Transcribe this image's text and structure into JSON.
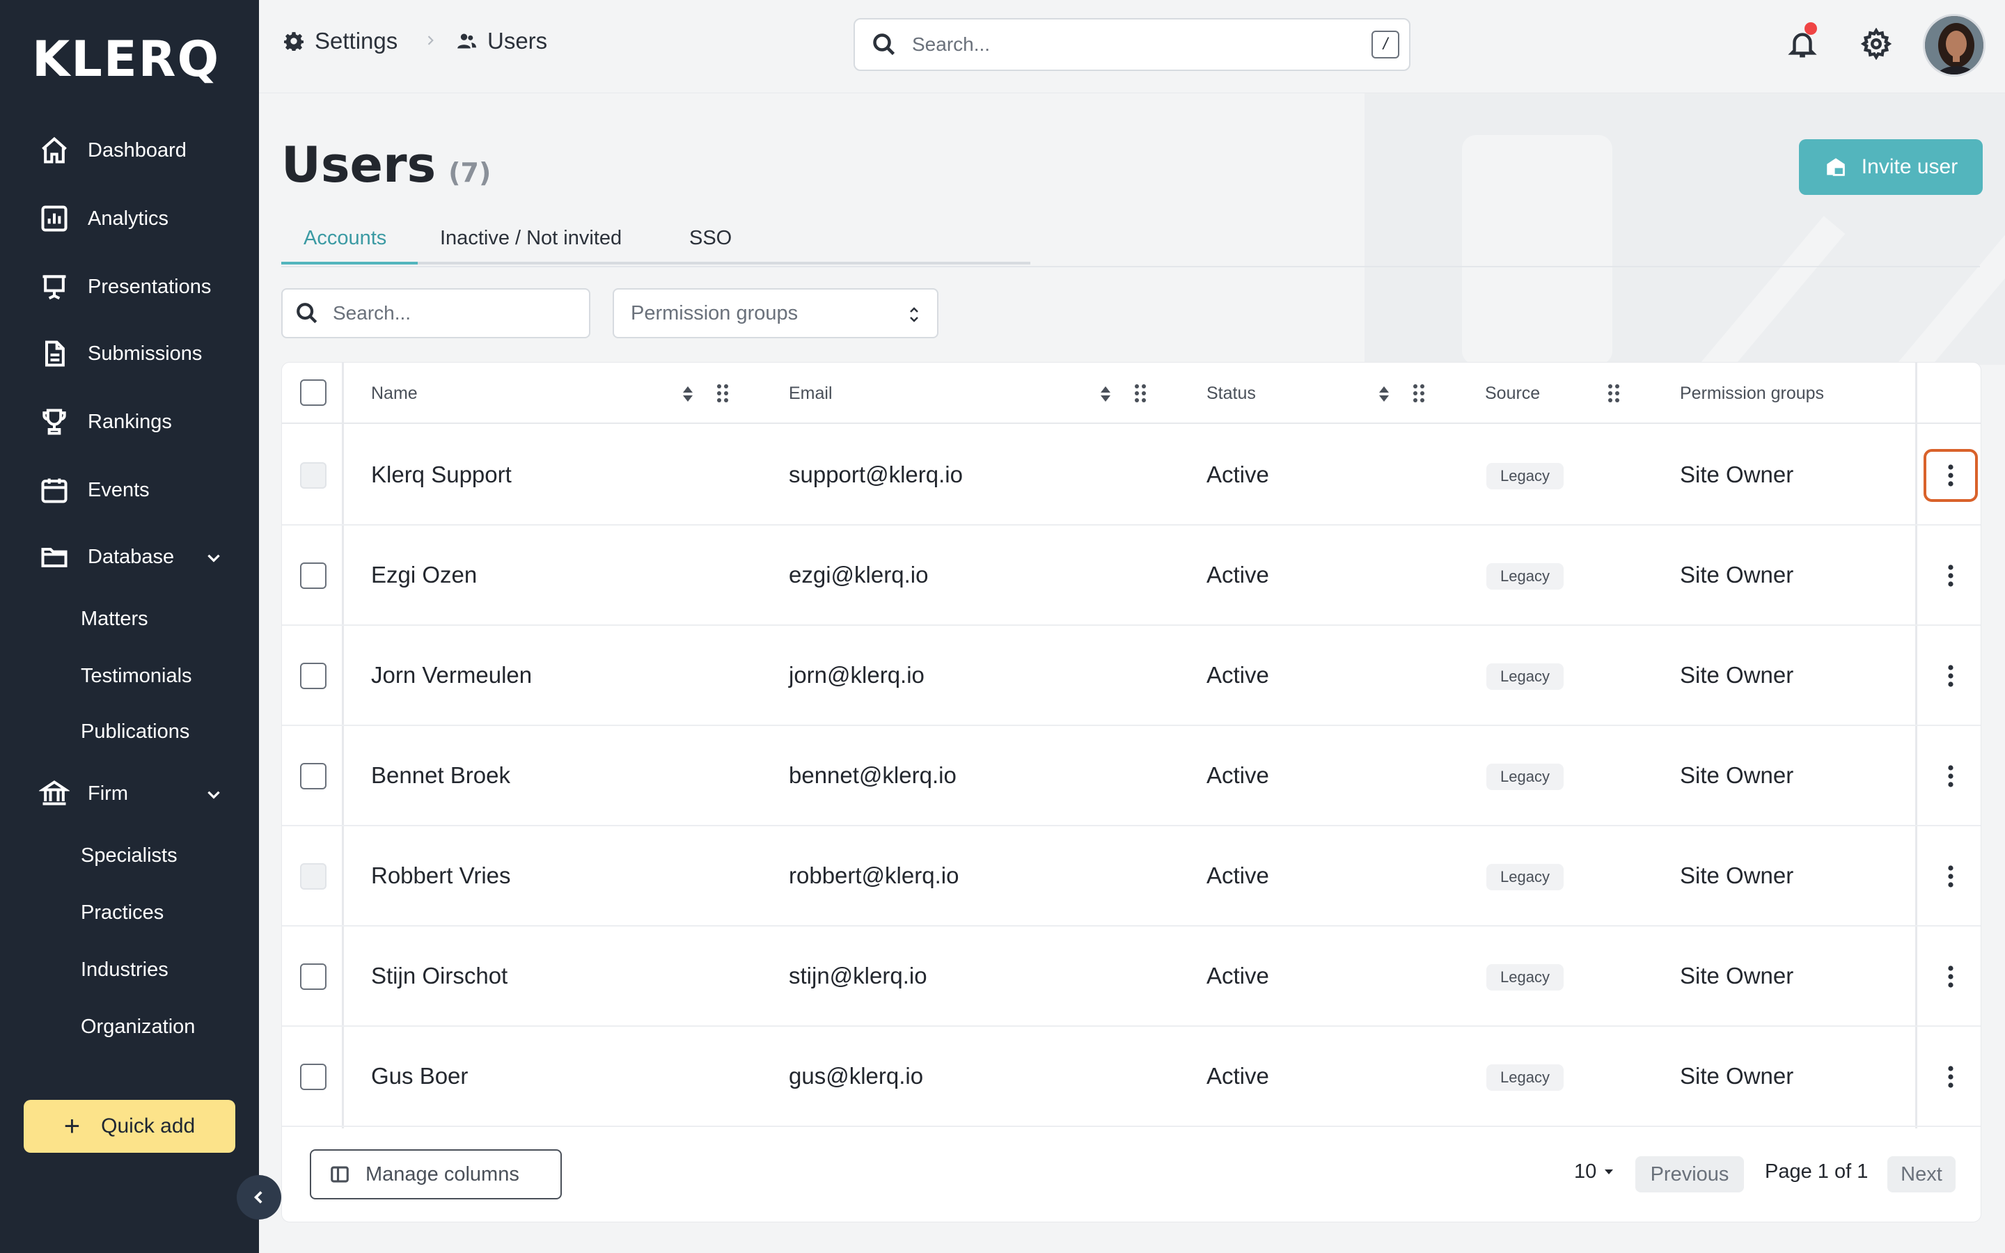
{
  "brand": {
    "logo_text": "KLERQ"
  },
  "sidebar": {
    "items": [
      {
        "label": "Dashboard",
        "icon": "home-icon"
      },
      {
        "label": "Analytics",
        "icon": "chart-icon"
      },
      {
        "label": "Presentations",
        "icon": "presentation-icon"
      },
      {
        "label": "Submissions",
        "icon": "document-icon"
      },
      {
        "label": "Rankings",
        "icon": "trophy-icon"
      },
      {
        "label": "Events",
        "icon": "calendar-icon"
      },
      {
        "label": "Database",
        "icon": "folder-icon",
        "expanded": true
      },
      {
        "label": "Firm",
        "icon": "bank-icon",
        "expanded": true
      }
    ],
    "database_children": [
      "Matters",
      "Testimonials",
      "Publications"
    ],
    "firm_children": [
      "Specialists",
      "Practices",
      "Industries",
      "Organization"
    ],
    "quick_add_label": "Quick add"
  },
  "breadcrumb": {
    "first": "Settings",
    "second": "Users"
  },
  "top_search": {
    "placeholder": "Search...",
    "shortcut": "/"
  },
  "notifications": {
    "has_unread": true
  },
  "page": {
    "title": "Users",
    "count": "(7)",
    "invite_label": "Invite user"
  },
  "tabs": [
    "Accounts",
    "Inactive / Not invited",
    "SSO"
  ],
  "filters": {
    "search_placeholder": "Search...",
    "permission_placeholder": "Permission groups"
  },
  "table": {
    "columns": [
      "Name",
      "Email",
      "Status",
      "Source",
      "Permission groups"
    ],
    "rows": [
      {
        "name": "Klerq Support",
        "email": "support@klerq.io",
        "status": "Active",
        "source": "Legacy",
        "permission": "Site Owner",
        "checkbox_disabled": true
      },
      {
        "name": "Ezgi Ozen",
        "email": "ezgi@klerq.io",
        "status": "Active",
        "source": "Legacy",
        "permission": "Site Owner",
        "checkbox_disabled": false
      },
      {
        "name": "Jorn Vermeulen",
        "email": "jorn@klerq.io",
        "status": "Active",
        "source": "Legacy",
        "permission": "Site Owner",
        "checkbox_disabled": false
      },
      {
        "name": "Bennet Broek",
        "email": "bennet@klerq.io",
        "status": "Active",
        "source": "Legacy",
        "permission": "Site Owner",
        "checkbox_disabled": false
      },
      {
        "name": "Robbert Vries",
        "email": "robbert@klerq.io",
        "status": "Active",
        "source": "Legacy",
        "permission": "Site Owner",
        "checkbox_disabled": true
      },
      {
        "name": "Stijn Oirschot",
        "email": "stijn@klerq.io",
        "status": "Active",
        "source": "Legacy",
        "permission": "Site Owner",
        "checkbox_disabled": false
      },
      {
        "name": "Gus Boer",
        "email": "gus@klerq.io",
        "status": "Active",
        "source": "Legacy",
        "permission": "Site Owner",
        "checkbox_disabled": false
      }
    ]
  },
  "footer": {
    "manage_columns_label": "Manage columns",
    "page_size": "10",
    "previous_label": "Previous",
    "page_info": "Page 1 of 1",
    "next_label": "Next"
  },
  "colors": {
    "sidebar_bg": "#1f2733",
    "accent": "#53b5bd",
    "quick_add": "#fce38a",
    "focus_ring": "#d9622b"
  }
}
